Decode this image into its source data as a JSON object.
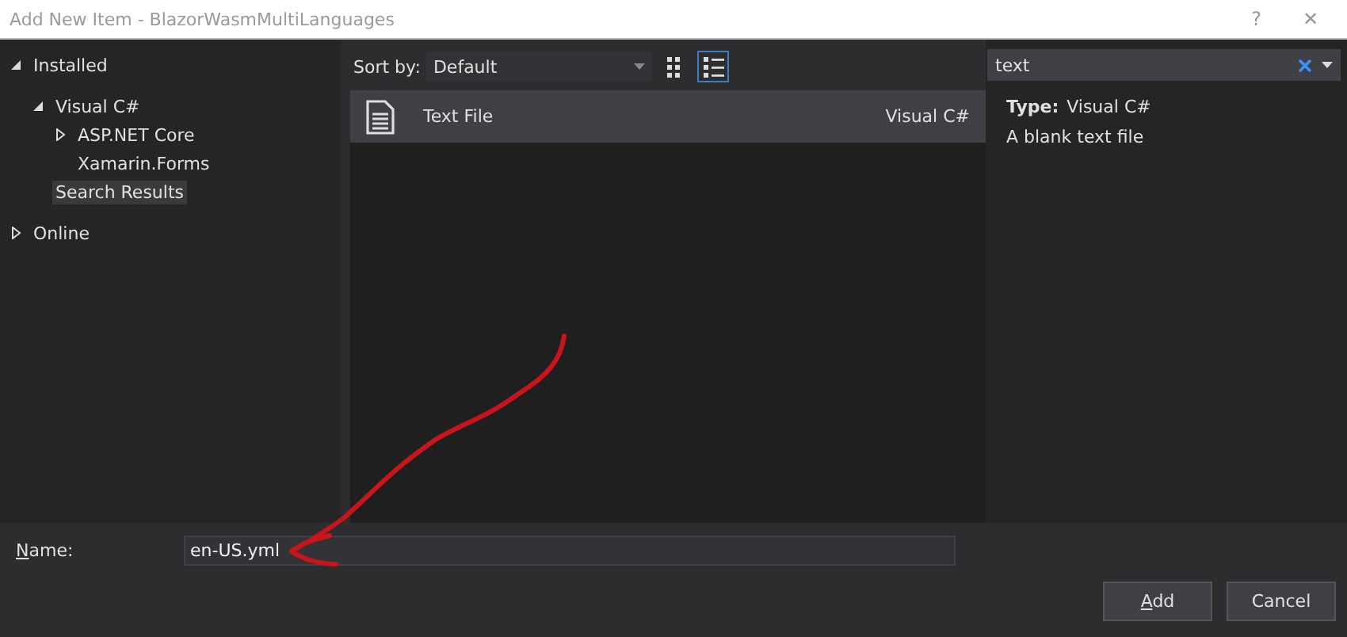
{
  "window": {
    "title": "Add New Item - BlazorWasmMultiLanguages",
    "help": "?",
    "close": "✕"
  },
  "tree": [
    {
      "label": "Installed",
      "expanded": true,
      "selected": false,
      "children": [
        {
          "label": "Visual C#",
          "expanded": true,
          "selected": false,
          "children": [
            {
              "label": "ASP.NET Core",
              "expanded": false,
              "selected": false
            },
            {
              "label": "Xamarin.Forms",
              "selected": false
            }
          ]
        },
        {
          "label": "Search Results",
          "selected": true
        }
      ]
    },
    {
      "label": "Online",
      "expanded": false,
      "selected": false
    }
  ],
  "sort": {
    "label": "Sort by:",
    "value": "Default"
  },
  "views": [
    {
      "kind": "grid",
      "selected": false
    },
    {
      "kind": "list",
      "selected": true
    }
  ],
  "templates": [
    {
      "name": "Text File",
      "language": "Visual C#",
      "selected": true
    }
  ],
  "search": {
    "value": "text"
  },
  "details": {
    "type_label": "Type:",
    "type_value": "Visual C#",
    "description": "A blank text file"
  },
  "name_field": {
    "label": "Name:",
    "value": "en-US.yml"
  },
  "buttons": [
    "Add",
    "Cancel"
  ]
}
